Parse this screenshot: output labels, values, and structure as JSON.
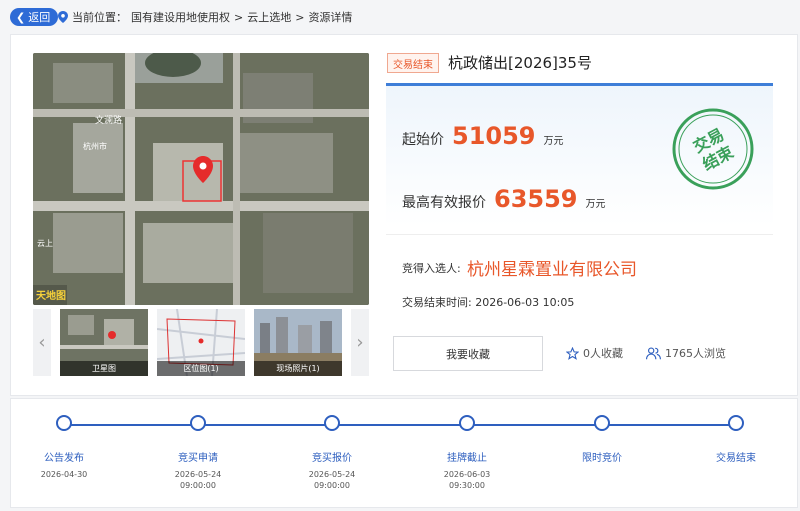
{
  "nav": {
    "back_label": "返回",
    "location_label": "当前位置：",
    "crumbs": [
      "国有建设用地使用权",
      "云上选地",
      "资源详情"
    ],
    "separator": ">"
  },
  "gallery": {
    "thumbs": [
      {
        "caption": "卫星图"
      },
      {
        "caption": "区位图(1)"
      },
      {
        "caption": "现场照片(1)"
      }
    ],
    "prev_icon": "chevron-left-icon",
    "next_icon": "chevron-right-icon",
    "map_labels": [
      "文澜路",
      "杭州市",
      "云上"
    ]
  },
  "detail": {
    "status": "交易结束",
    "title": "杭政储出[2026]35号",
    "start_price_label": "起始价",
    "start_price": "51059",
    "start_price_unit": "万元",
    "max_price_label": "最高有效报价",
    "max_price": "63559",
    "max_price_unit": "万元",
    "stamp_text": [
      "交易",
      "结束"
    ],
    "winner_label": "竞得入选人:",
    "winner": "杭州星霖置业有限公司",
    "end_time_label": "交易结束时间:",
    "end_time": "2026-06-03 10:05",
    "favorite_button": "我要收藏",
    "favorites": "0人收藏",
    "views": "1765人浏览",
    "colors": {
      "accent": "#2e5fbf",
      "price": "#e8572a",
      "stamp": "#3aa05a"
    }
  },
  "timeline": {
    "steps": [
      {
        "label": "公告发布",
        "date": "2026-04-30",
        "time": ""
      },
      {
        "label": "竞买申请",
        "date": "2026-05-24",
        "time": "09:00:00"
      },
      {
        "label": "竞买报价",
        "date": "2026-05-24",
        "time": "09:00:00"
      },
      {
        "label": "挂牌截止",
        "date": "2026-06-03",
        "time": "09:30:00"
      },
      {
        "label": "限时竞价",
        "date": "",
        "time": ""
      },
      {
        "label": "交易结束",
        "date": "",
        "time": ""
      }
    ]
  }
}
